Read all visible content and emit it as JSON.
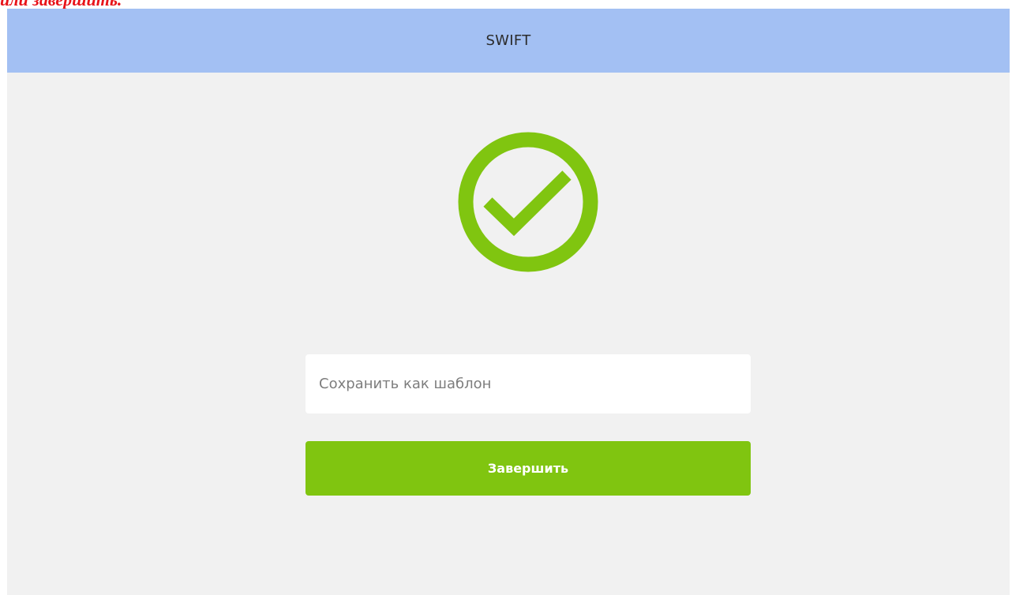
{
  "caption": {
    "text": "или завершить."
  },
  "header": {
    "title": "SWIFT",
    "background": "#a3c0f3"
  },
  "success": {
    "icon": "check-circle-icon",
    "color": "#80c510"
  },
  "form": {
    "template_input": {
      "placeholder": "Сохранить как шаблон",
      "value": ""
    },
    "finish_button": {
      "label": "Завершить",
      "color": "#80c510"
    }
  }
}
